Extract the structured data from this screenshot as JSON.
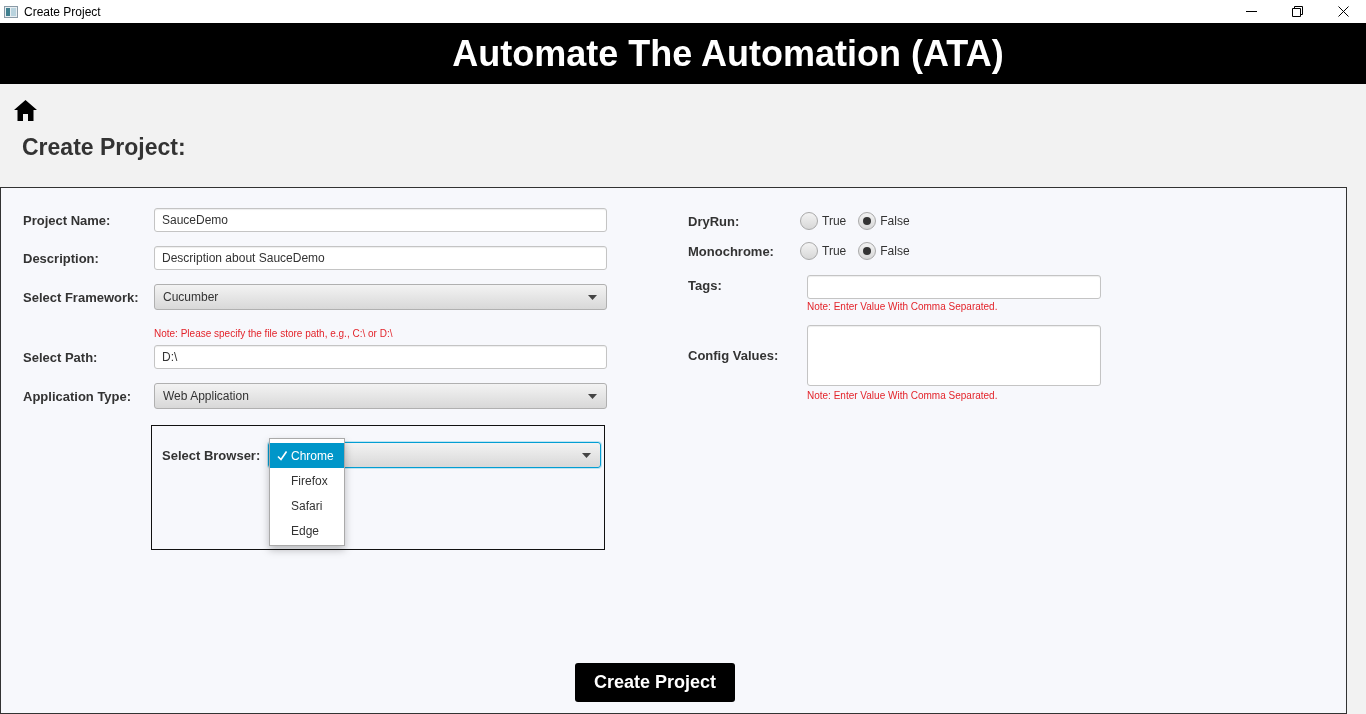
{
  "window": {
    "title": "Create Project"
  },
  "header": {
    "title": "Automate The Automation (ATA)"
  },
  "page_title": "Create Project:",
  "form": {
    "left_fields": [
      {
        "kind": "text",
        "label": "Project Name:",
        "value": "SauceDemo"
      },
      {
        "kind": "text",
        "label": "Description:",
        "value": "Description about SauceDemo"
      },
      {
        "kind": "dropdown",
        "label": "Select Framework:",
        "value": "Cucumber"
      },
      {
        "kind": "note",
        "text": "Note: Please specify the file store path, e.g., C:\\ or D:\\"
      },
      {
        "kind": "text",
        "label": "Select Path:",
        "value": "D:\\"
      },
      {
        "kind": "dropdown",
        "label": "Application Type:",
        "value": "Web Application"
      }
    ],
    "browser": {
      "label": "Select Browser:",
      "focused": true,
      "expanded": true,
      "options": [
        {
          "label": "Chrome",
          "selected": true
        },
        {
          "label": "Firefox",
          "selected": false
        },
        {
          "label": "Safari",
          "selected": false
        },
        {
          "label": "Edge",
          "selected": false
        }
      ]
    },
    "right_fields": [
      {
        "kind": "radio",
        "label": "DryRun:",
        "options": [
          {
            "label": "True",
            "selected": false
          },
          {
            "label": "False",
            "selected": true
          }
        ]
      },
      {
        "kind": "radio",
        "label": "Monochrome:",
        "options": [
          {
            "label": "True",
            "selected": false
          },
          {
            "label": "False",
            "selected": true
          }
        ]
      },
      {
        "kind": "text",
        "label": "Tags:",
        "note": "Note: Enter Value With Comma Separated."
      },
      {
        "kind": "textarea",
        "label": "Config Values:",
        "note": "Note: Enter Value With Comma Separated."
      }
    ],
    "submit_button": "Create Project"
  }
}
